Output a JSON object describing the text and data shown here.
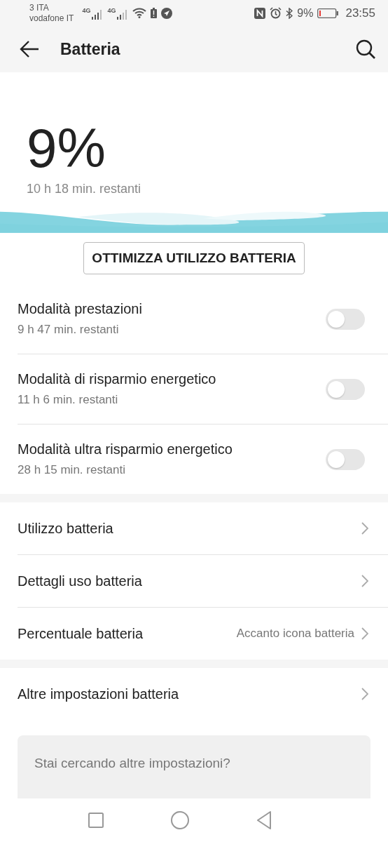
{
  "status_bar": {
    "carrier_1": "3 ITA",
    "carrier_2": "vodafone IT",
    "network_1": "4G",
    "network_2": "4G",
    "battery_text": "9%",
    "time": "23:55"
  },
  "header": {
    "title": "Batteria"
  },
  "battery": {
    "percent": "9%",
    "remaining": "10 h 18 min. restanti"
  },
  "optimize_button": "OTTIMIZZA UTILIZZO BATTERIA",
  "modes": [
    {
      "title": "Modalità prestazioni",
      "subtitle": "9 h 47 min. restanti",
      "on": false
    },
    {
      "title": "Modalità di risparmio energetico",
      "subtitle": "11 h 6 min. restanti",
      "on": false
    },
    {
      "title": "Modalità ultra risparmio energetico",
      "subtitle": "28 h 15 min. restanti",
      "on": false
    }
  ],
  "groups": [
    [
      {
        "label": "Utilizzo batteria"
      },
      {
        "label": "Dettagli uso batteria"
      },
      {
        "label": "Percentuale batteria",
        "value": "Accanto icona batteria"
      }
    ],
    [
      {
        "label": "Altre impostazioni batteria"
      }
    ]
  ],
  "search": {
    "placeholder": "Stai cercando altre impostazioni?"
  }
}
